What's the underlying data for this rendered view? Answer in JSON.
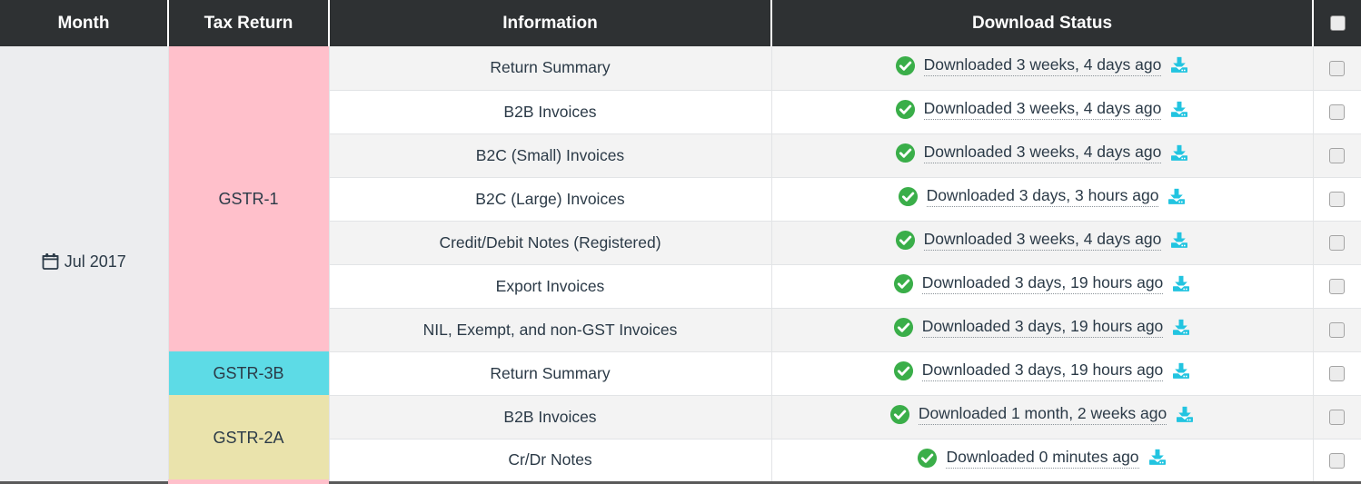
{
  "table": {
    "columns": [
      {
        "key": "month",
        "label": "Month"
      },
      {
        "key": "return",
        "label": "Tax Return"
      },
      {
        "key": "info",
        "label": "Information"
      },
      {
        "key": "status",
        "label": "Download Status"
      },
      {
        "key": "select",
        "label": ""
      }
    ],
    "header_select_all_checkbox": {
      "icon": "checkbox-icon",
      "checked": false
    },
    "month": {
      "label": "Jul 2017",
      "icon": "calendar-icon"
    },
    "tax_returns": [
      {
        "label": "GSTR-1",
        "color": "#FFC0CB",
        "rowspan": 7
      },
      {
        "label": "GSTR-3B",
        "color": "#5DDBE6",
        "rowspan": 1
      },
      {
        "label": "GSTR-2A",
        "color": "#EAE3AC",
        "rowspan": 2
      }
    ],
    "rows": [
      {
        "information": "Return Summary",
        "status": "Downloaded 3 weeks, 4 days ago",
        "status_icon": "check-circle-icon",
        "download_icon": "download-icon",
        "checkbox": false
      },
      {
        "information": "B2B Invoices",
        "status": "Downloaded 3 weeks, 4 days ago",
        "status_icon": "check-circle-icon",
        "download_icon": "download-icon",
        "checkbox": false
      },
      {
        "information": "B2C (Small) Invoices",
        "status": "Downloaded 3 weeks, 4 days ago",
        "status_icon": "check-circle-icon",
        "download_icon": "download-icon",
        "checkbox": false
      },
      {
        "information": "B2C (Large) Invoices",
        "status": "Downloaded 3 days, 3 hours ago",
        "status_icon": "check-circle-icon",
        "download_icon": "download-icon",
        "checkbox": false
      },
      {
        "information": "Credit/Debit Notes (Registered)",
        "status": "Downloaded 3 weeks, 4 days ago",
        "status_icon": "check-circle-icon",
        "download_icon": "download-icon",
        "checkbox": false
      },
      {
        "information": "Export Invoices",
        "status": "Downloaded 3 days, 19 hours ago",
        "status_icon": "check-circle-icon",
        "download_icon": "download-icon",
        "checkbox": false
      },
      {
        "information": "NIL, Exempt, and non-GST Invoices",
        "status": "Downloaded 3 days, 19 hours ago",
        "status_icon": "check-circle-icon",
        "download_icon": "download-icon",
        "checkbox": false
      },
      {
        "information": "Return Summary",
        "status": "Downloaded 3 days, 19 hours ago",
        "status_icon": "check-circle-icon",
        "download_icon": "download-icon",
        "checkbox": false
      },
      {
        "information": "B2B Invoices",
        "status": "Downloaded 1 month, 2 weeks ago",
        "status_icon": "check-circle-icon",
        "download_icon": "download-icon",
        "checkbox": false
      },
      {
        "information": "Cr/Dr Notes",
        "status": "Downloaded 0 minutes ago",
        "status_icon": "check-circle-icon",
        "download_icon": "download-icon",
        "checkbox": false
      }
    ]
  },
  "colors": {
    "header_bg": "#2E3133",
    "header_text": "#FFFFFF",
    "stripe_bg": "#F3F3F3",
    "row_bg": "#FFFFFF",
    "month_bg": "#ECEDEF",
    "text": "#2B3A47",
    "success_green": "#3AAE49",
    "download_cyan": "#22C4E0",
    "gstr1_pink": "#FFC0CB",
    "gstr3b_cyan": "#5DDBE6",
    "gstr2a_khaki": "#EAE3AC"
  }
}
